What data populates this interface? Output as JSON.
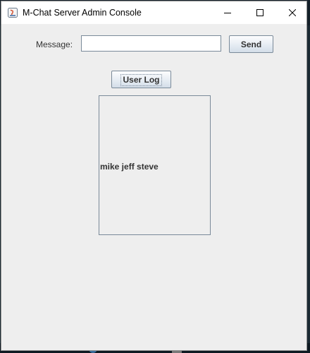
{
  "window": {
    "title": "M-Chat Server Admin Console",
    "controls": [
      "minimize-icon",
      "maximize-icon",
      "close-icon"
    ]
  },
  "message": {
    "label": "Message:",
    "value": "",
    "placeholder": ""
  },
  "buttons": {
    "send_label": "Send",
    "user_log_label": "User Log"
  },
  "log": {
    "users_text": "mike jeff steve"
  },
  "colors": {
    "window_bg": "#eeeeee",
    "titlebar_bg": "#ffffff",
    "border": "#7a8a99",
    "text": "#333333"
  }
}
